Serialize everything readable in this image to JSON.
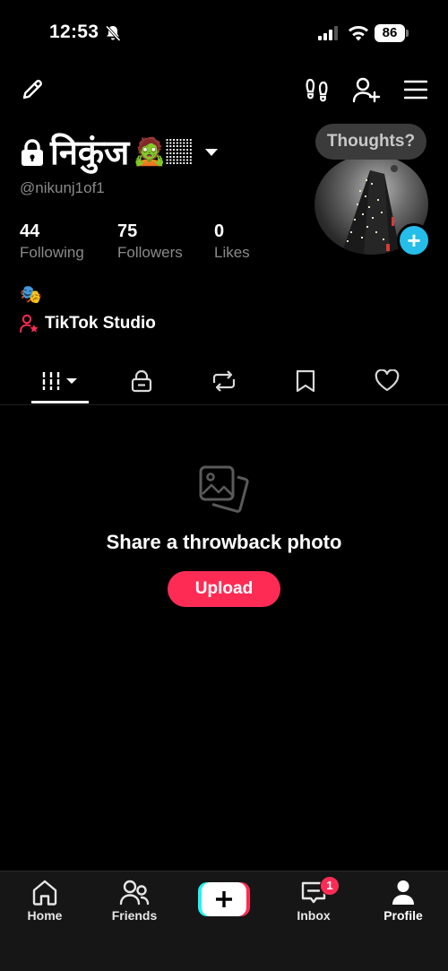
{
  "status_bar": {
    "time": "12:53",
    "battery": "86"
  },
  "profile": {
    "display_name": "निकुंज",
    "name_emoji": "🧟🏽",
    "username": "@nikunj1of1",
    "bio_emoji": "🎭",
    "studio_link": "TikTok Studio",
    "stats": [
      {
        "value": "44",
        "label": "Following"
      },
      {
        "value": "75",
        "label": "Followers"
      },
      {
        "value": "0",
        "label": "Likes"
      }
    ],
    "thought_bubble": "Thoughts?"
  },
  "tabs": [
    "videos-grid",
    "private",
    "reposts",
    "saved",
    "liked"
  ],
  "empty_state": {
    "title": "Share a throwback photo",
    "button": "Upload"
  },
  "bottom_nav": {
    "items": [
      {
        "label": "Home"
      },
      {
        "label": "Friends"
      },
      {
        "label": "Inbox"
      },
      {
        "label": "Profile"
      }
    ],
    "inbox_badge": "1"
  },
  "colors": {
    "accent": "#fe2c55",
    "cyan": "#25f4ee",
    "avatar_add": "#25bde9"
  }
}
